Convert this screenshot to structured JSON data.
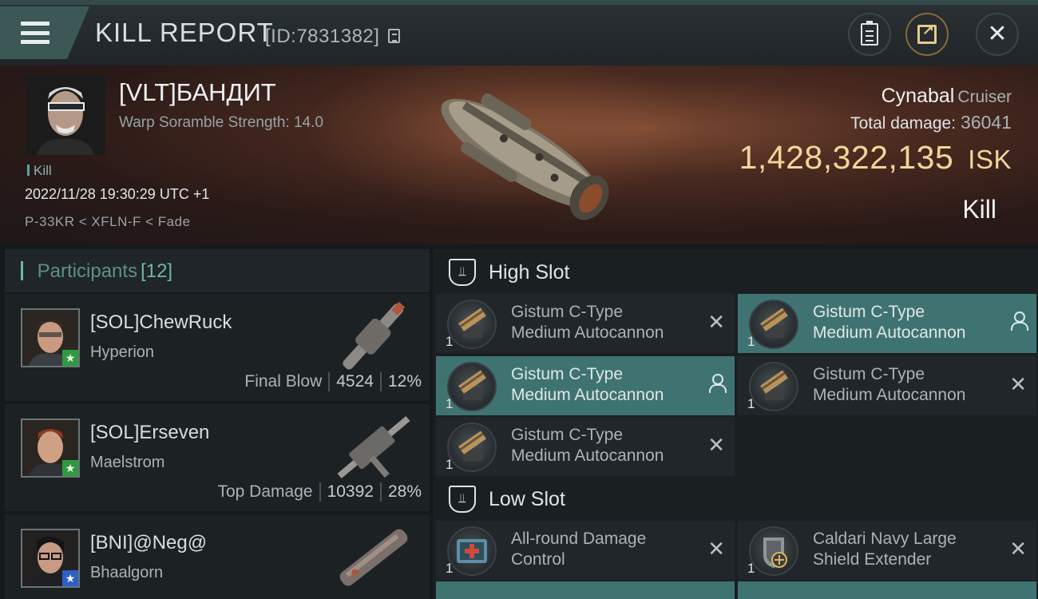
{
  "header": {
    "title": "KILL REPORT",
    "report_id": "[ID:7831382]",
    "icons": [
      "menu-icon",
      "copy-icon",
      "clipboard-icon",
      "share-icon",
      "close-icon"
    ]
  },
  "victim": {
    "name": "[VLT]БАНДИТ",
    "subtitle": "Warp Soramble Strength: 14.0",
    "tag": "Kill",
    "timestamp": "2022/11/28 19:30:29 UTC +1",
    "location": "P-33KR < XFLN-F < Fade"
  },
  "summary": {
    "ship": "Cynabal",
    "ship_class": "Cruiser",
    "damage_label": "Total damage:",
    "damage_value": "36041",
    "isk_value": "1,428,322,135",
    "isk_unit": "ISK",
    "kind": "Kill"
  },
  "participants": {
    "label": "Participants",
    "count": "[12]",
    "rows": [
      {
        "name": "[SOL]ChewRuck",
        "ship": "Hyperion",
        "role": "Final Blow",
        "damage": "4524",
        "percent": "12%",
        "badge": "green"
      },
      {
        "name": "[SOL]Erseven",
        "ship": "Maelstrom",
        "role": "Top Damage",
        "damage": "10392",
        "percent": "28%",
        "badge": "green"
      },
      {
        "name": "[BNI]@Neg@",
        "ship": "Bhaalgorn",
        "role": "",
        "damage": "",
        "percent": "",
        "badge": "blue"
      }
    ]
  },
  "fitting": {
    "high_slot": {
      "title": "High Slot",
      "modules": [
        {
          "name1": "Gistum C-Type",
          "name2": "Medium Autocannon",
          "qty": "1",
          "status": "destroyed"
        },
        {
          "name1": "Gistum C-Type",
          "name2": "Medium Autocannon",
          "qty": "1",
          "status": "dropped"
        },
        {
          "name1": "Gistum C-Type",
          "name2": "Medium Autocannon",
          "qty": "1",
          "status": "dropped"
        },
        {
          "name1": "Gistum C-Type",
          "name2": "Medium Autocannon",
          "qty": "1",
          "status": "destroyed"
        },
        {
          "name1": "Gistum C-Type",
          "name2": "Medium Autocannon",
          "qty": "1",
          "status": "destroyed"
        }
      ]
    },
    "low_slot": {
      "title": "Low Slot",
      "modules": [
        {
          "name1": "All-round Damage",
          "name2": "Control",
          "qty": "1",
          "status": "destroyed"
        },
        {
          "name1": "Caldari Navy Large",
          "name2": "Shield Extender",
          "qty": "1",
          "status": "destroyed"
        }
      ]
    }
  },
  "colors": {
    "accent_teal": "#3f7371",
    "isk_gold": "#f2d59a",
    "badge_green": "#2f9a3f",
    "badge_blue": "#2d5fc4"
  }
}
